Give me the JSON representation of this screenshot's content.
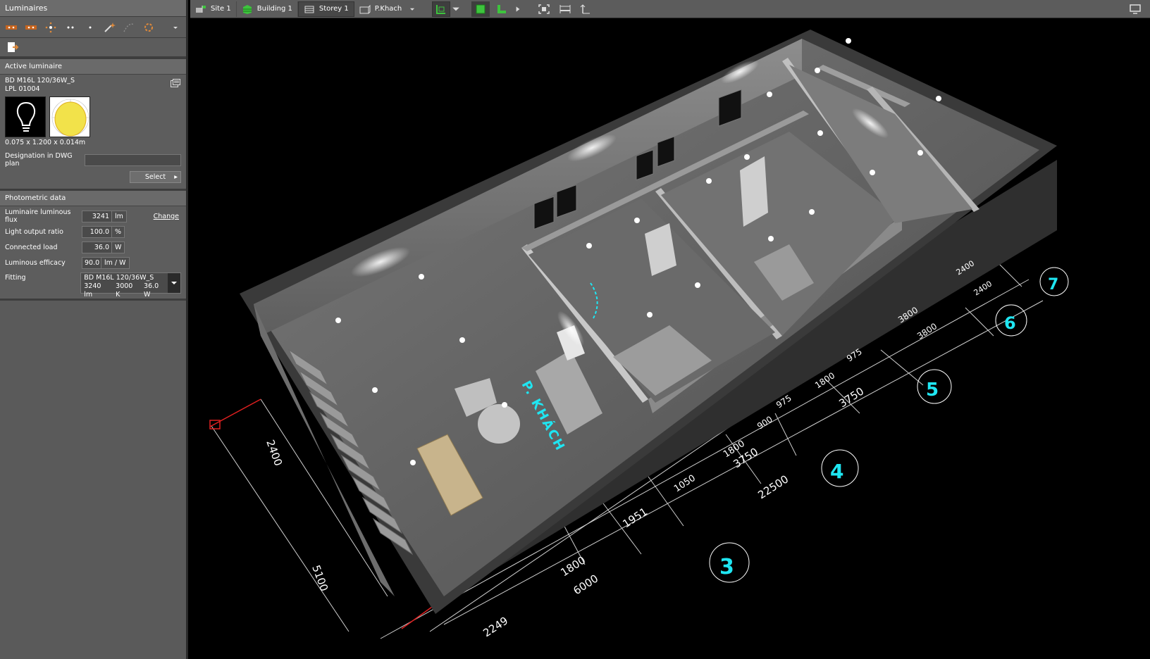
{
  "panel": {
    "title": "Luminaires",
    "active_section": "Active luminaire",
    "luminaire_name": "BD M16L 120/36W_S",
    "luminaire_code": "LPL 01004",
    "dimensions": "0.075 x 1.200 x 0.014m",
    "designation_label": "Designation in DWG plan",
    "designation_value": "",
    "select_label": "Select",
    "photometric_section": "Photometric data",
    "flux_label": "Luminaire luminous flux",
    "flux_value": "3241",
    "flux_unit": "lm",
    "change_label": "Change",
    "lor_label": "Light output ratio",
    "lor_value": "100.0",
    "lor_unit": "%",
    "load_label": "Connected load",
    "load_value": "36.0",
    "load_unit": "W",
    "efficacy_label": "Luminous efficacy",
    "efficacy_value": "90.0",
    "efficacy_unit": "lm / W",
    "fitting_label": "Fitting",
    "fitting_name": "BD M16L 120/36W_S",
    "fitting_flux": "3240 lm",
    "fitting_temp": "3000 K",
    "fitting_power": "36.0 W"
  },
  "breadcrumb": {
    "site": "Site 1",
    "building": "Building 1",
    "storey": "Storey 1",
    "room": "P.Khach"
  },
  "scene": {
    "room_label": "P. KHÁCH",
    "axis_labels": [
      "3",
      "4",
      "5",
      "6",
      "7"
    ],
    "dims_outer": [
      "2249",
      "6000",
      "3750",
      "3750",
      "3800",
      "2400"
    ],
    "dims_inner": [
      "1800",
      "1951",
      "1050",
      "1800",
      "900",
      "975",
      "1800",
      "975",
      "3800",
      "2400"
    ],
    "dim_total": "22500",
    "dims_side": [
      "2400",
      "5100"
    ]
  },
  "colors": {
    "accent_cyan": "#1fe6f2",
    "panel_bg": "#5a5a5a",
    "dim_red": "#e02020"
  }
}
